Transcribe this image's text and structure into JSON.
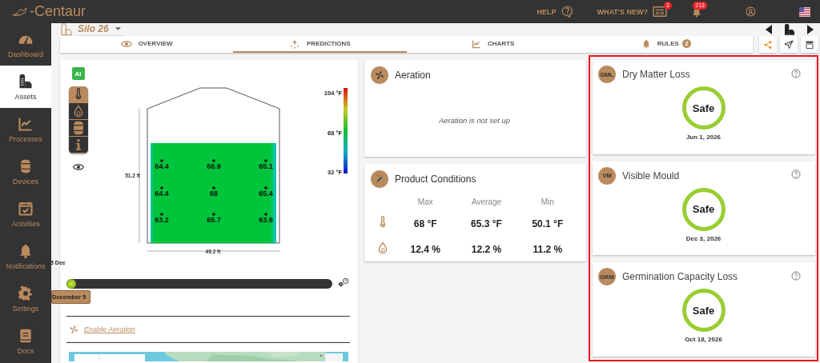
{
  "topbar": {
    "logo": "-Centaur",
    "help": "HELP",
    "whats_new": "WHAT'S NEW?",
    "whats_new_badge": "2",
    "notifications_badge": "213"
  },
  "sidebar": {
    "items": [
      {
        "label": "Dashboard",
        "selected": false
      },
      {
        "label": "Assets",
        "selected": true
      },
      {
        "label": "Processes",
        "selected": false
      },
      {
        "label": "Devices",
        "selected": false
      },
      {
        "label": "Activities",
        "selected": false
      },
      {
        "label": "Notifications",
        "selected": false
      },
      {
        "label": "Settings",
        "selected": false
      },
      {
        "label": "Docs",
        "selected": false
      }
    ]
  },
  "asset": {
    "name": "Silo 26"
  },
  "tabs": [
    {
      "label": "OVERVIEW",
      "selected": false
    },
    {
      "label": "PREDICTIONS",
      "selected": true
    },
    {
      "label": "CHARTS",
      "selected": false
    },
    {
      "label": "RULES",
      "badge": "2",
      "selected": false
    }
  ],
  "silo": {
    "ai_badge": "AI",
    "layers": [
      {
        "kind": "temperature",
        "selected": true
      },
      {
        "kind": "moisture",
        "selected": false
      },
      {
        "kind": "device",
        "selected": false
      },
      {
        "kind": "info",
        "selected": false
      }
    ],
    "scale": [
      "104 °F",
      "68 °F",
      "32 °F"
    ],
    "height": "51.2 ft",
    "width": "49.2 ft",
    "sensors": [
      "64.4",
      "66.9",
      "65.1",
      "64.4",
      "68",
      "65.4",
      "63.2",
      "65.7",
      "63.9"
    ],
    "timeline": {
      "start_label": "5 Dec",
      "date": "December 5",
      "level": 0
    },
    "enable_aeration": "Enable Aeration"
  },
  "aeration": {
    "title": "Aeration",
    "message": "Aeration is not set up"
  },
  "conditions": {
    "title": "Product Conditions",
    "columns": [
      "Max",
      "Average",
      "Min"
    ],
    "rows": [
      {
        "kind": "temperature",
        "values": [
          "68 °F",
          "65.3 °F",
          "50.1 °F"
        ]
      },
      {
        "kind": "moisture",
        "values": [
          "12.4 %",
          "12.2 %",
          "11.2 %"
        ]
      }
    ]
  },
  "predictions": [
    {
      "abbr": "DML",
      "title": "Dry Matter Loss",
      "status": "Safe",
      "date": "Jun 1, 2026"
    },
    {
      "abbr": "VM",
      "title": "Visible Mould",
      "status": "Safe",
      "date": "Dec 3, 2026"
    },
    {
      "abbr": "GRM",
      "title": "Germination Capacity Loss",
      "status": "Safe",
      "date": "Oct 18, 2026"
    }
  ]
}
